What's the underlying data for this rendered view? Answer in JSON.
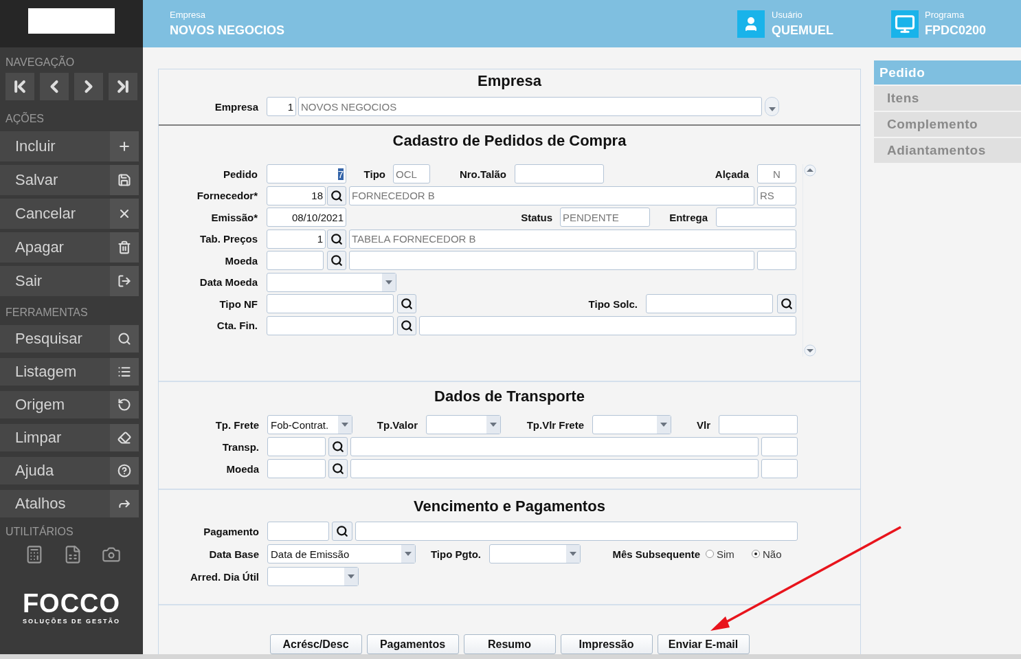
{
  "header": {
    "company_label": "Empresa",
    "company": "NOVOS NEGOCIOS",
    "user_label": "Usuário",
    "user": "QUEMUEL",
    "program_label": "Programa",
    "program": "FPDC0200"
  },
  "sidebar": {
    "navigation": {
      "title": "NAVEGAÇÃO",
      "buttons": [
        {
          "kind": "first"
        },
        {
          "kind": "prev"
        },
        {
          "kind": "next"
        },
        {
          "kind": "last"
        }
      ]
    },
    "actions": {
      "title": "AÇÕES",
      "items": [
        {
          "label": "Incluir",
          "kind": "plus"
        },
        {
          "label": "Salvar",
          "kind": "save"
        },
        {
          "label": "Cancelar",
          "kind": "close"
        },
        {
          "label": "Apagar",
          "kind": "trash"
        },
        {
          "label": "Sair",
          "kind": "exit"
        }
      ]
    },
    "tools": {
      "title": "FERRAMENTAS",
      "items": [
        {
          "label": "Pesquisar",
          "kind": "search"
        },
        {
          "label": "Listagem",
          "kind": "list"
        },
        {
          "label": "Origem",
          "kind": "undo"
        },
        {
          "label": "Limpar",
          "kind": "eraser"
        },
        {
          "label": "Ajuda",
          "kind": "help"
        },
        {
          "label": "Atalhos",
          "kind": "shortcut"
        }
      ]
    },
    "utilities": {
      "title": "UTILITÁRIOS",
      "buttons": [
        {
          "kind": "calculator"
        },
        {
          "kind": "spreadsheet"
        },
        {
          "kind": "camera"
        }
      ]
    },
    "logo": {
      "name": "FOCCO",
      "tagline": "SOLUÇÕES DE GESTÃO"
    }
  },
  "form": {
    "sections": [
      {
        "title": "Empresa",
        "kind": "plain",
        "rows": [
          [
            {
              "kind": "label",
              "text": "Empresa"
            },
            {
              "kind": "number",
              "value": "1",
              "readonly": false
            },
            {
              "kind": "text",
              "value": "NOVOS NEGOCIOS",
              "readonly": true
            },
            {
              "kind": "dropdown"
            }
          ]
        ]
      },
      {
        "title": "Cadastro de Pedidos de Compra",
        "kind": "scroll",
        "rows": [
          [
            {
              "kind": "label",
              "text": "Pedido"
            },
            {
              "kind": "number",
              "value": "7",
              "readonly": false,
              "highlighted": true
            },
            {
              "kind": "label",
              "text": "Tipo"
            },
            {
              "kind": "text",
              "value": "OCL",
              "readonly": true
            },
            {
              "kind": "label",
              "text": "Nro.Talão"
            },
            {
              "kind": "text"
            },
            {
              "kind": "label",
              "text": "Alçada"
            },
            {
              "kind": "center",
              "value": "N",
              "readonly": true
            }
          ],
          [
            {
              "kind": "label",
              "text": "Fornecedor*"
            },
            {
              "kind": "number",
              "value": "18",
              "readonly": false
            },
            {
              "kind": "lookup"
            },
            {
              "kind": "text",
              "value": "FORNECEDOR B",
              "readonly": true
            },
            {
              "kind": "text",
              "value": "RS",
              "readonly": true
            }
          ],
          [
            {
              "kind": "label",
              "text": "Emissão*"
            },
            {
              "kind": "number",
              "value": "08/10/2021",
              "readonly": false
            },
            {
              "kind": "label",
              "text": "Status"
            },
            {
              "kind": "text",
              "value": "PENDENTE",
              "readonly": true
            },
            {
              "kind": "label",
              "text": "Entrega"
            },
            {
              "kind": "text"
            }
          ],
          [
            {
              "kind": "label",
              "text": "Tab. Preços"
            },
            {
              "kind": "number",
              "value": "1",
              "readonly": false
            },
            {
              "kind": "lookup"
            },
            {
              "kind": "text",
              "value": "TABELA FORNECEDOR B",
              "readonly": true
            }
          ],
          [
            {
              "kind": "label",
              "text": "Moeda"
            },
            {
              "kind": "text"
            },
            {
              "kind": "lookup"
            },
            {
              "kind": "text"
            },
            {
              "kind": "text"
            }
          ],
          [
            {
              "kind": "label",
              "text": "Data Moeda"
            },
            {
              "kind": "select"
            }
          ],
          [
            {
              "kind": "label",
              "text": "Tipo NF"
            },
            {
              "kind": "text"
            },
            {
              "kind": "lookup"
            },
            {
              "kind": "label",
              "text": "Tipo Solc."
            },
            {
              "kind": "text"
            },
            {
              "kind": "lookup"
            }
          ],
          [
            {
              "kind": "label",
              "text": "Cta. Fin."
            },
            {
              "kind": "text"
            },
            {
              "kind": "lookup"
            },
            {
              "kind": "text"
            }
          ]
        ]
      },
      {
        "title": "Dados de Transporte",
        "kind": "plain",
        "rows": [
          [
            {
              "kind": "label",
              "text": "Tp. Frete"
            },
            {
              "kind": "select",
              "value": "Fob-Contrat."
            },
            {
              "kind": "label",
              "text": "Tp.Valor"
            },
            {
              "kind": "select"
            },
            {
              "kind": "label",
              "text": "Tp.Vlr Frete"
            },
            {
              "kind": "select"
            },
            {
              "kind": "label",
              "text": "Vlr"
            },
            {
              "kind": "text"
            }
          ],
          [
            {
              "kind": "label",
              "text": "Transp."
            },
            {
              "kind": "text"
            },
            {
              "kind": "lookup"
            },
            {
              "kind": "text"
            },
            {
              "kind": "text"
            }
          ],
          [
            {
              "kind": "label",
              "text": "Moeda"
            },
            {
              "kind": "text"
            },
            {
              "kind": "lookup"
            },
            {
              "kind": "text"
            },
            {
              "kind": "text"
            }
          ]
        ]
      },
      {
        "title": "Vencimento e Pagamentos",
        "kind": "plain",
        "rows": [
          [
            {
              "kind": "label",
              "text": "Pagamento"
            },
            {
              "kind": "text"
            },
            {
              "kind": "lookup"
            },
            {
              "kind": "text"
            }
          ],
          [
            {
              "kind": "label",
              "text": "Data Base"
            },
            {
              "kind": "select",
              "value": "Data de Emissão"
            },
            {
              "kind": "label",
              "text": "Tipo Pgto."
            },
            {
              "kind": "select"
            },
            {
              "kind": "label",
              "text": "Mês Subsequente"
            },
            {
              "kind": "radio",
              "label": "Sim",
              "selected": false
            },
            {
              "kind": "radio",
              "label": "Não",
              "selected": true
            }
          ],
          [
            {
              "kind": "label",
              "text": "Arred. Dia Útil"
            },
            {
              "kind": "select"
            }
          ]
        ]
      }
    ],
    "buttons": [
      "Acrésc/Desc",
      "Pagamentos",
      "Resumo",
      "Impressão",
      "Enviar E-mail"
    ]
  },
  "tabs": [
    {
      "label": "Pedido",
      "selected": true
    },
    {
      "label": "Itens",
      "selected": false
    },
    {
      "label": "Complemento",
      "selected": false
    },
    {
      "label": "Adiantamentos",
      "selected": false
    }
  ],
  "annotation": {
    "kind": "arrow"
  }
}
